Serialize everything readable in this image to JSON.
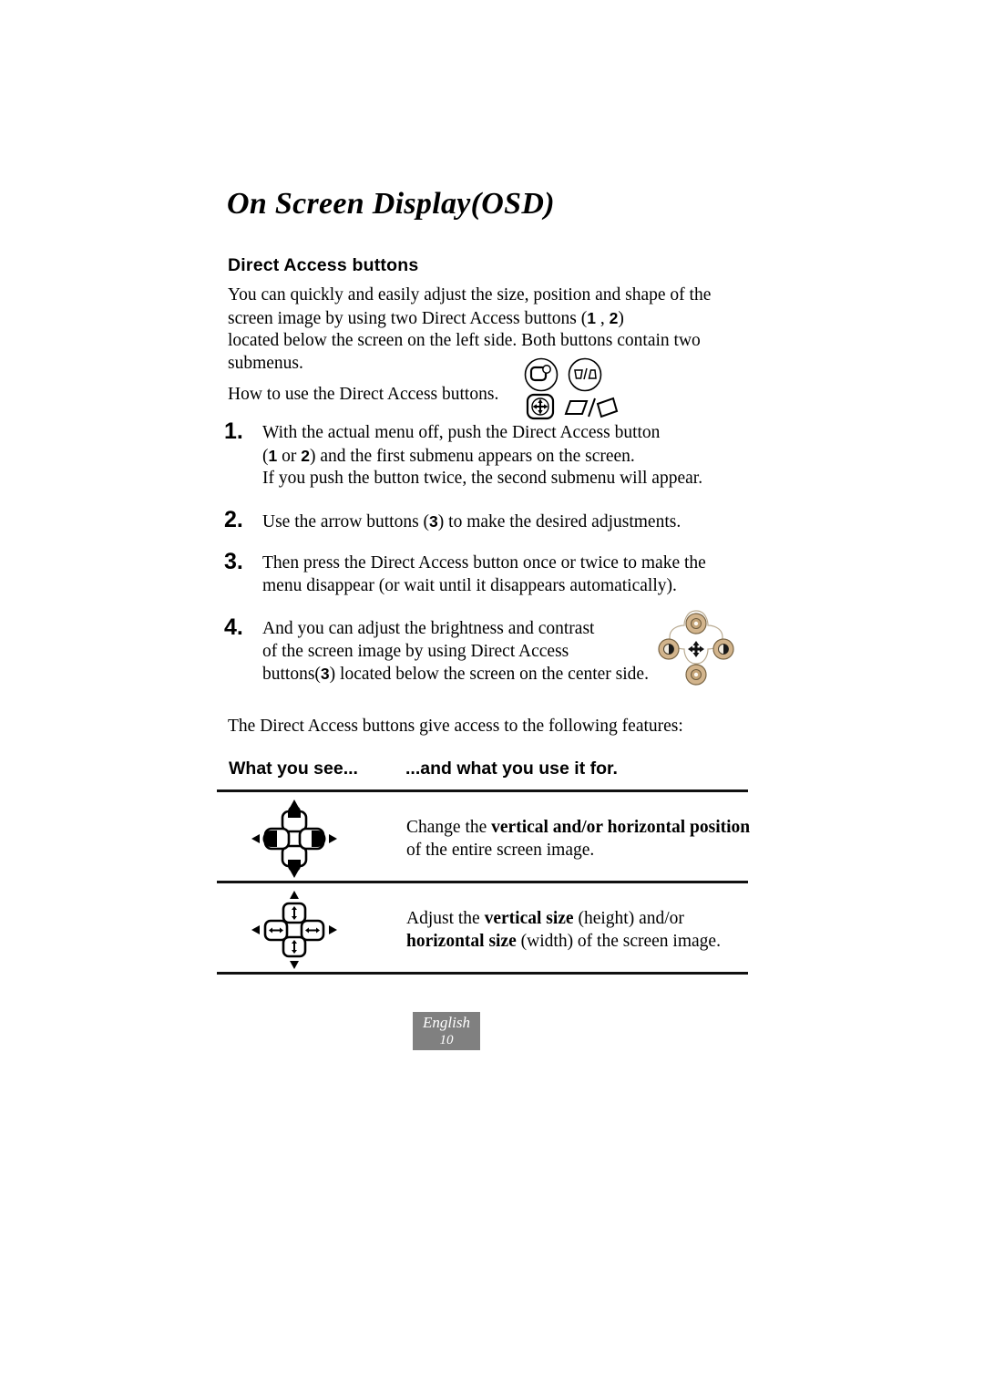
{
  "page": {
    "title": "On Screen Display(OSD)",
    "section_heading": "Direct Access buttons"
  },
  "intro": {
    "line1": "You can quickly and easily adjust the size, position and shape of the",
    "line2_a": "screen image by using two Direct Access buttons (",
    "line2_btn1": "1",
    "line2_sep": " , ",
    "line2_btn2": "2",
    "line2_b": ")",
    "line3": "located below the screen on the left side. Both buttons contain two",
    "line4": "submenus.",
    "howto": "How to use the Direct Access buttons."
  },
  "intro_icons": [
    {
      "name": "size-icon",
      "label": "size"
    },
    {
      "name": "pincushion-trapezoid-icon",
      "label": "pincushion / trapezoid"
    },
    {
      "name": "position-icon",
      "label": "position"
    },
    {
      "name": "parallelogram-rotation-icon",
      "label": "parallelogram / rotation"
    }
  ],
  "steps": [
    {
      "number": "1.",
      "line1": "With the actual menu off, push the Direct Access button",
      "line2_a": "(",
      "line2_btn1": "1",
      "line2_or": " or  ",
      "line2_btn2": "2",
      "line2_b": ") and the first submenu appears on the screen.",
      "line3": "If you push the button twice, the second submenu will appear."
    },
    {
      "number": "2.",
      "line1_a": "Use the arrow buttons (",
      "line1_btn": "3",
      "line1_b": ") to make the desired adjustments."
    },
    {
      "number": "3.",
      "line1": "Then press the Direct Access button once or twice to make the",
      "line2": "menu disappear (or wait until it disappears automatically)."
    },
    {
      "number": "4.",
      "line1": "And you can adjust the brightness and contrast",
      "line2": "of the screen image by using Direct Access",
      "line3_a": "buttons(",
      "line3_btn": "3",
      "line3_b": ") located below the screen on the center side."
    }
  ],
  "features_lead": "The Direct Access buttons give access to the following features:",
  "table": {
    "headers": {
      "col1": "What you see...",
      "col2": "...and what you use it for."
    },
    "rows": [
      {
        "icon_name": "position-adjust-icon-group",
        "text_line1_a": "Change the ",
        "text_line1_bold": "vertical and/or horizontal position",
        "text_line2": "of the entire screen image."
      },
      {
        "icon_name": "size-adjust-icon-group",
        "text_line1_a": "Adjust the ",
        "text_line1_bold": "vertical size",
        "text_line1_b": " (height) and/or",
        "text_line2_bold": "horizontal size",
        "text_line2_b": " (width) of the screen image."
      }
    ]
  },
  "footer": {
    "language": "English",
    "page_number": "10",
    "background": "#808080"
  },
  "photo": {
    "name": "direct-access-buttons-photo",
    "button_color": "#d2b48c",
    "button_shadow": "#8a7450"
  }
}
